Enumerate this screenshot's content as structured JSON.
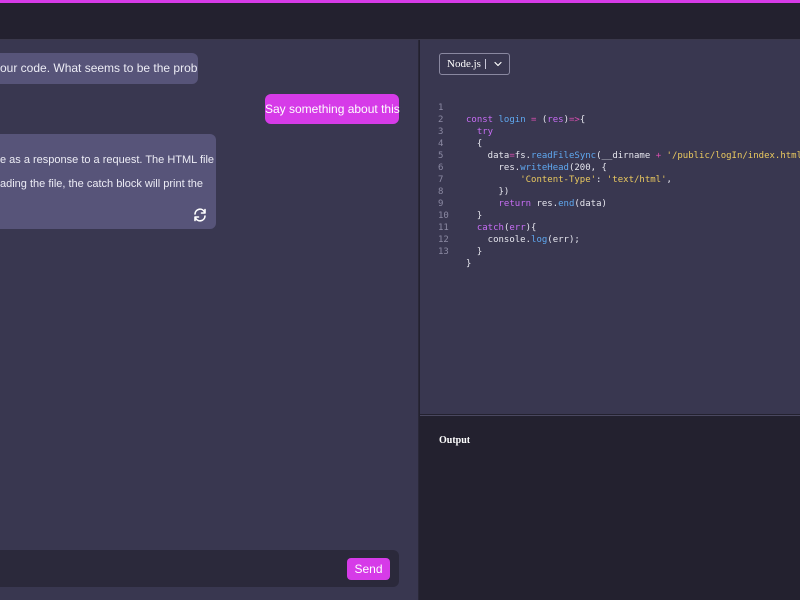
{
  "chat": {
    "messages": [
      {
        "role": "assistant",
        "text": "our code. What seems to be the problem?"
      },
      {
        "role": "user",
        "text": "Say something about this"
      },
      {
        "role": "assistant",
        "lines": [
          "e as a response to a request. The HTML file",
          "ading the file, the catch block will print the"
        ]
      }
    ],
    "input": {
      "value": "",
      "placeholder": ""
    },
    "send_label": "Send"
  },
  "editor": {
    "language": "Node.js",
    "line_numbers": [
      "1",
      "2",
      "3",
      "4",
      "5",
      "6",
      "7",
      "8",
      "9",
      "10",
      "11",
      "12",
      "13"
    ]
  },
  "output": {
    "title": "Output",
    "content": ""
  },
  "colors": {
    "accent": "#d63be8",
    "panel_bg": "#393750",
    "dark_bg": "#23212f",
    "bubble_bg": "#575479"
  },
  "icons": [
    "regenerate-icon",
    "chevron-down-icon"
  ]
}
